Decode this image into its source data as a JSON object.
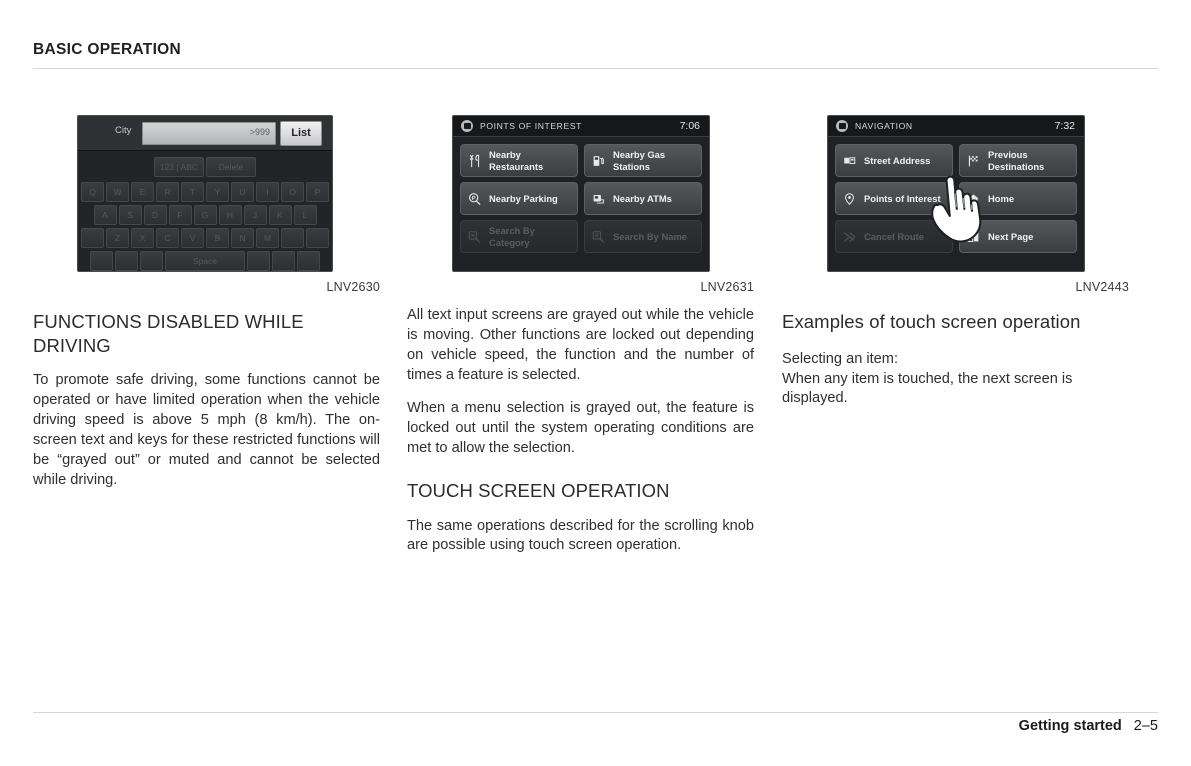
{
  "header": {
    "title": "BASIC OPERATION"
  },
  "footer": {
    "section": "Getting started",
    "page": "2–5"
  },
  "columns": {
    "col1": {
      "figure_caption": "LNV2630",
      "heading": "FUNCTIONS DISABLED WHILE DRIVING",
      "paragraphs": [
        "To promote safe driving, some functions cannot be operated or have limited operation when the vehicle driving speed is above 5 mph (8 km/h). The on-screen text and keys for these restricted functions will be “grayed out” or muted and cannot be selected while driving."
      ]
    },
    "col2": {
      "figure_caption": "LNV2631",
      "paragraphs": [
        "All text input screens are grayed out while the vehicle is moving. Other functions are locked out depending on vehicle speed, the function and the number of times a feature is selected.",
        "When a menu selection is grayed out, the feature is locked out until the system operating conditions are met to allow the selection."
      ],
      "heading2": "TOUCH SCREEN OPERATION",
      "paragraphs2": [
        "The same operations described for the scrolling knob are possible using touch screen operation."
      ]
    },
    "col3": {
      "figure_caption": "LNV2443",
      "heading": "Examples of touch screen operation",
      "paragraphs": [
        "Selecting an item:",
        "When any item is touched, the next screen is displayed."
      ]
    }
  },
  "screens": {
    "keyboard": {
      "field_label": "City",
      "input_value": "",
      "match_count": ">999",
      "list_button": "List",
      "fn_keys": [
        "123 | ABC",
        "Delete"
      ],
      "rows": [
        [
          "Q",
          "W",
          "E",
          "R",
          "T",
          "Y",
          "U",
          "I",
          "O",
          "P"
        ],
        [
          "A",
          "S",
          "D",
          "F",
          "G",
          "H",
          "J",
          "K",
          "L"
        ],
        [
          "Z",
          "X",
          "C",
          "V",
          "B",
          "N",
          "M"
        ]
      ],
      "space_key": "Space"
    },
    "poi": {
      "title": "POINTS OF INTEREST",
      "time": "7:06",
      "buttons": [
        {
          "label": "Nearby Restaurants",
          "icon": "restaurant-icon",
          "disabled": false
        },
        {
          "label": "Nearby Gas Stations",
          "icon": "gas-pump-icon",
          "disabled": false
        },
        {
          "label": "Nearby Parking",
          "icon": "parking-search-icon",
          "disabled": false
        },
        {
          "label": "Nearby ATMs",
          "icon": "atm-icon",
          "disabled": false
        },
        {
          "label": "Search By Category",
          "icon": "category-search-icon",
          "disabled": true
        },
        {
          "label": "Search By Name",
          "icon": "name-search-icon",
          "disabled": true
        }
      ]
    },
    "navigation": {
      "title": "NAVIGATION",
      "time": "7:32",
      "buttons": [
        {
          "label": "Street Address",
          "icon": "street-sign-icon",
          "disabled": false
        },
        {
          "label": "Previous Destinations",
          "icon": "flag-icon",
          "disabled": false
        },
        {
          "label": "Points of Interest",
          "icon": "map-pin-icon",
          "disabled": false
        },
        {
          "label": "Home",
          "icon": "home-icon",
          "disabled": false
        },
        {
          "label": "Cancel Route",
          "icon": "cancel-route-icon",
          "disabled": true
        },
        {
          "label": "Next Page",
          "icon": "next-page-icon",
          "disabled": false
        }
      ],
      "cursor": "pointing-hand-cursor"
    }
  },
  "colors": {
    "page_background": "#ffffff",
    "text": "#2f2f2f",
    "rule": "#d6d6d6",
    "screen_bezel": "#4c4c4c",
    "screen_background": "#202124",
    "button_enabled": "#55575b",
    "button_disabled": "#2f3134"
  }
}
